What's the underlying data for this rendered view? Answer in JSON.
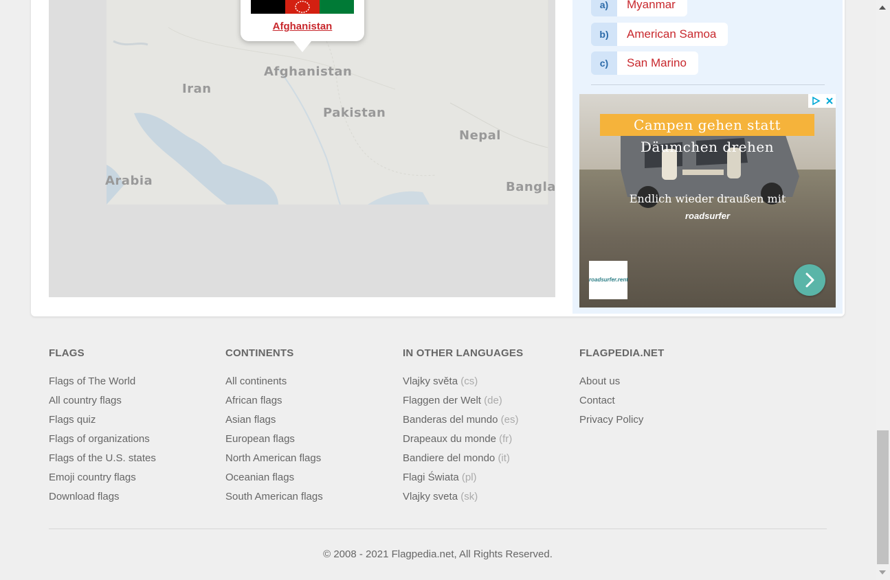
{
  "map": {
    "popup_country": "Afghanistan",
    "flag_colors": [
      "#000000",
      "#d32011",
      "#007a36"
    ],
    "labels": [
      "Afghanistan",
      "Iran",
      "Pakistan",
      "Nepal",
      "Arabia",
      "Bangla"
    ]
  },
  "quiz": {
    "answers": [
      {
        "letter": "a)",
        "name": "Myanmar"
      },
      {
        "letter": "b)",
        "name": "American Samoa"
      },
      {
        "letter": "c)",
        "name": "San Marino"
      }
    ]
  },
  "ad": {
    "headline": "Campen gehen statt Däumchen drehen",
    "subline": "Endlich wieder draußen mit",
    "brand": "roadsurfer",
    "logo_text": "roadsurfer.rent"
  },
  "footer": {
    "columns": [
      {
        "title": "FLAGS",
        "links": [
          {
            "label": "Flags of The World"
          },
          {
            "label": "All country flags"
          },
          {
            "label": "Flags quiz"
          },
          {
            "label": "Flags of organizations"
          },
          {
            "label": "Flags of the U.S. states"
          },
          {
            "label": "Emoji country flags"
          },
          {
            "label": "Download flags"
          }
        ]
      },
      {
        "title": "CONTINENTS",
        "links": [
          {
            "label": "All continents"
          },
          {
            "label": "African flags"
          },
          {
            "label": "Asian flags"
          },
          {
            "label": "European flags"
          },
          {
            "label": "North American flags"
          },
          {
            "label": "Oceanian flags"
          },
          {
            "label": "South American flags"
          }
        ]
      },
      {
        "title": "IN OTHER LANGUAGES",
        "links": [
          {
            "label": "Vlajky světa",
            "code": "(cs)"
          },
          {
            "label": "Flaggen der Welt",
            "code": "(de)"
          },
          {
            "label": "Banderas del mundo",
            "code": "(es)"
          },
          {
            "label": "Drapeaux du monde",
            "code": "(fr)"
          },
          {
            "label": "Bandiere del mondo",
            "code": "(it)"
          },
          {
            "label": "Flagi Świata",
            "code": "(pl)"
          },
          {
            "label": "Vlajky sveta",
            "code": "(sk)"
          }
        ]
      },
      {
        "title": "FLAGPEDIA.NET",
        "links": [
          {
            "label": "About us"
          },
          {
            "label": "Contact"
          },
          {
            "label": "Privacy Policy"
          }
        ]
      }
    ],
    "copyright": "© 2008 - 2021 Flagpedia.net, All Rights Reserved."
  }
}
